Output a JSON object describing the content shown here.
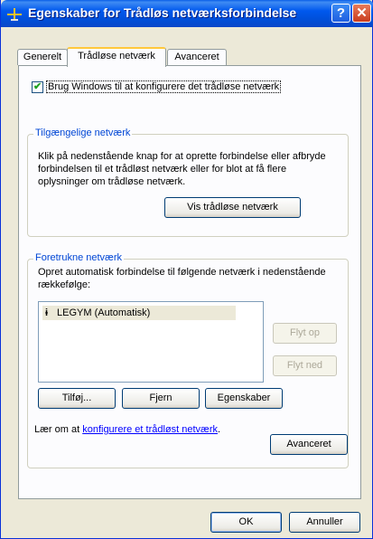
{
  "window": {
    "title": "Egenskaber for Trådløs netværksforbindelse",
    "help_glyph": "?",
    "close_glyph": "✕"
  },
  "tabs": [
    {
      "label": "Generelt"
    },
    {
      "label": "Trådløse netværk",
      "active": true
    },
    {
      "label": "Avanceret"
    }
  ],
  "use_windows_checkbox": {
    "checked": true,
    "label": "Brug Windows til at konfigurere det trådløse netværk"
  },
  "available_networks": {
    "title": "Tilgængelige netværk",
    "description": "Klik på nedenstående knap for at oprette forbindelse eller afbryde forbindelsen til et trådløst netværk eller for blot at få flere oplysninger om trådløse netværk.",
    "view_button": "Vis trådløse netværk"
  },
  "preferred_networks": {
    "title": "Foretrukne netværk",
    "description": "Opret automatisk forbindelse til følgende netværk i nedenstående rækkefølge:",
    "items": [
      {
        "label": "LEGYM (Automatisk)",
        "icon": "wireless-antenna-icon"
      }
    ],
    "move_up": "Flyt op",
    "move_down": "Flyt ned",
    "add": "Tilføj...",
    "remove": "Fjern",
    "properties": "Egenskaber",
    "learn_prefix": "Lær om at",
    "learn_link": "konfigurere et trådløst netværk",
    "learn_suffix": ".",
    "advanced": "Avanceret"
  },
  "footer": {
    "ok": "OK",
    "cancel": "Annuller"
  }
}
